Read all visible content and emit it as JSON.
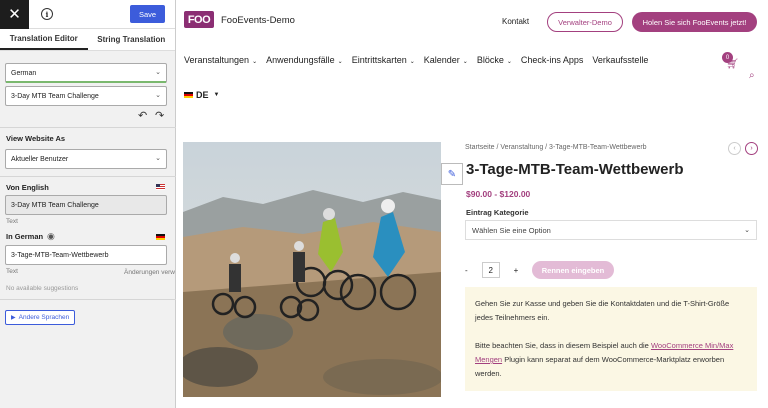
{
  "editor": {
    "save_label": "Save",
    "tabs": [
      "Translation Editor",
      "String Translation"
    ],
    "language_select": "German",
    "string_select": "3-Day MTB Team Challenge",
    "view_as_label": "View Website As",
    "view_as_value": "Aktueller Benutzer",
    "from_label": "Von English",
    "from_value": "3-Day MTB Team Challenge",
    "from_sub": "Text",
    "in_label": "In German",
    "in_value": "3-Tage-MTB-Team-Wettbewerb",
    "in_sub": "Text",
    "changes_label": "Änderungen verw",
    "suggestions": "No available suggestions",
    "other_langs": "Andere Sprachen"
  },
  "site": {
    "brand": "FooEvents-Demo",
    "logo": "FOO",
    "contact": "Kontakt",
    "organizer_demo": "Verwalter-Demo",
    "cta": "Holen Sie sich FooEvents jetzt!",
    "menu": [
      "Veranstaltungen",
      "Anwendungsfälle",
      "Eintrittskarten",
      "Kalender",
      "Blöcke",
      "Check-ins Apps",
      "Verkaufsstelle"
    ],
    "menu_has_arrow": [
      true,
      true,
      true,
      true,
      true,
      false,
      false
    ],
    "lang": "DE",
    "cart_count": "0",
    "breadcrumb": "Startseite / Veranstaltung / 3-Tage-MTB-Team-Wettbewerb",
    "product_title": "3-Tage-MTB-Team-Wettbewerb",
    "price": "$90.00 - $120.00",
    "entry_label": "Eintrag Kategorie",
    "entry_placeholder": "Wählen Sie eine Option",
    "qty_minus": "-",
    "qty_value": "2",
    "qty_plus": "+",
    "register_btn": "Rennen eingeben",
    "notice_p1": "Gehen Sie zur Kasse und geben Sie die Kontaktdaten und die T-Shirt-Größe jedes Teilnehmers ein.",
    "notice_p2_a": "Bitte beachten Sie, dass in diesem Beispiel auch die ",
    "notice_link": "WooCommerce Min/Max Mengen",
    "notice_p2_b": " Plugin kann separat auf dem WooCommerce-Marktplatz erworben werden."
  },
  "colors": {
    "accent": "#a3407f",
    "save": "#3c5cdb",
    "notice_bg": "#fbf7e4"
  }
}
